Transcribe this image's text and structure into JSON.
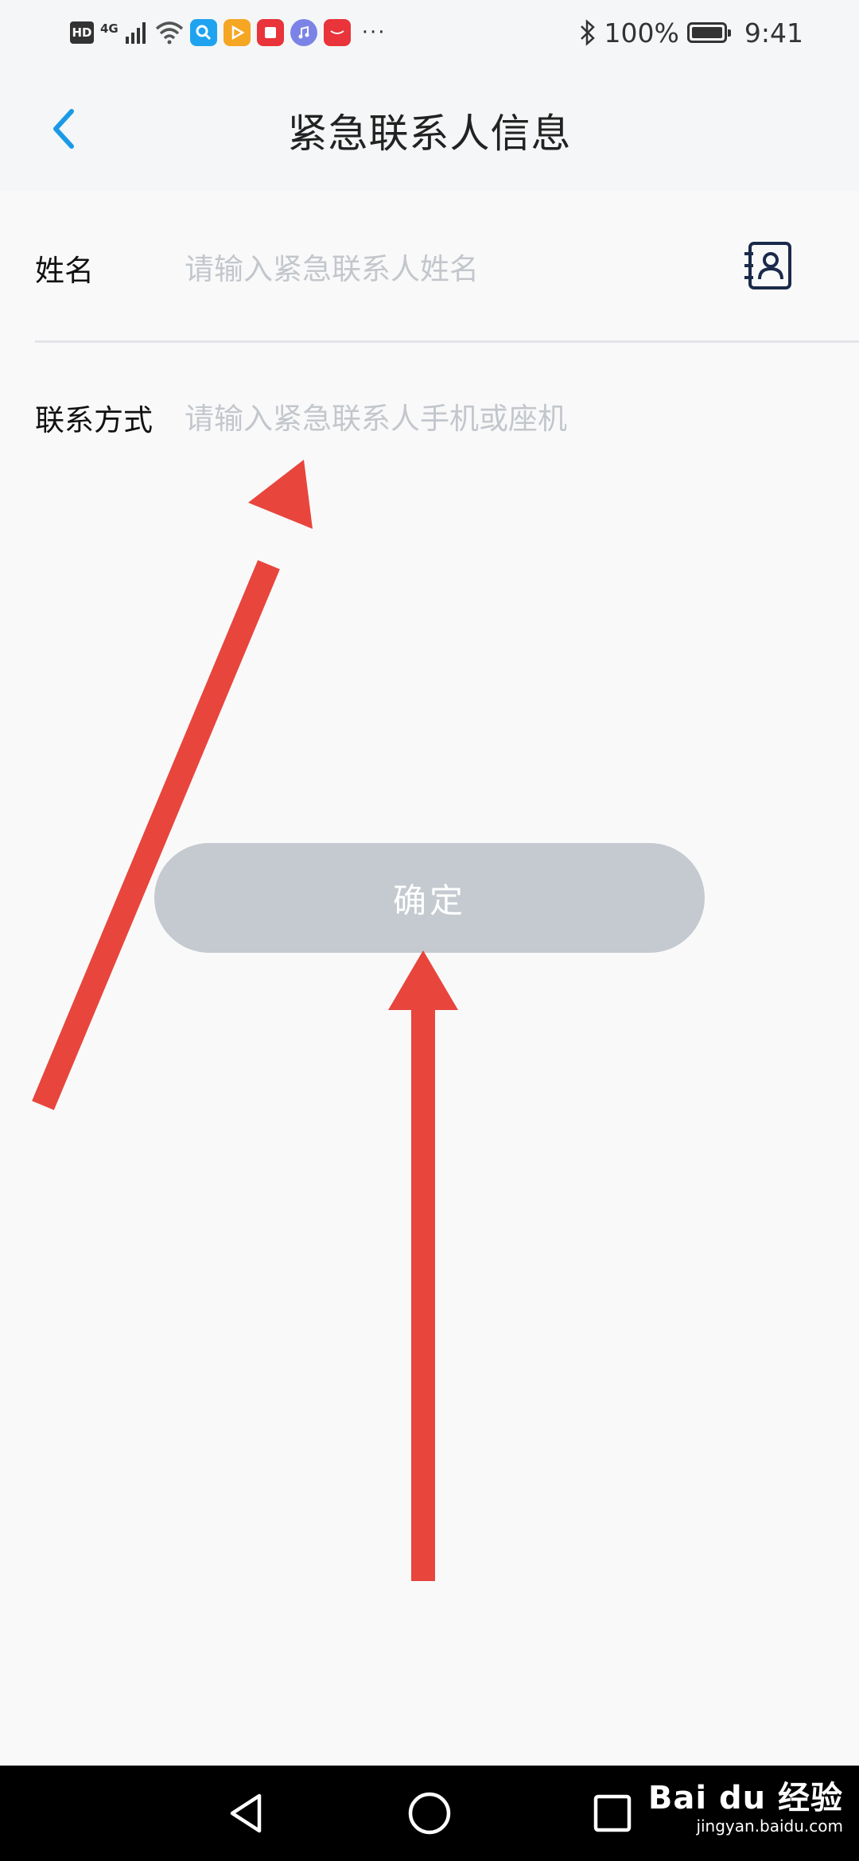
{
  "status_bar": {
    "hd_label": "HD",
    "network_label": "4G",
    "battery_text": "100%",
    "time": "9:41",
    "more": "···",
    "icons": [
      "hd-icon",
      "signal-icon",
      "wifi-icon",
      "search-app-icon",
      "video-app-icon",
      "reader-app-icon",
      "music-app-icon",
      "huawei-app-icon",
      "bluetooth-icon",
      "battery-icon"
    ]
  },
  "header": {
    "title": "紧急联系人信息",
    "back_icon": "chevron-left-icon"
  },
  "form": {
    "name": {
      "label": "姓名",
      "placeholder": "请输入紧急联系人姓名",
      "value": ""
    },
    "contact": {
      "label": "联系方式",
      "placeholder": "请输入紧急联系人手机或座机",
      "value": ""
    },
    "contacts_icon": "address-book-icon"
  },
  "confirm_button": {
    "label": "确定"
  },
  "nav_bar": {
    "icons": [
      "back-triangle-icon",
      "home-circle-icon",
      "recents-square-icon"
    ]
  },
  "watermark": {
    "main": "Bai du 经验",
    "sub": "jingyan.baidu.com"
  },
  "colors": {
    "accent": "#1a9ae6",
    "annotation_arrow": "#e8453c",
    "button_disabled": "#c4cacf",
    "placeholder": "#c3c7cc"
  }
}
